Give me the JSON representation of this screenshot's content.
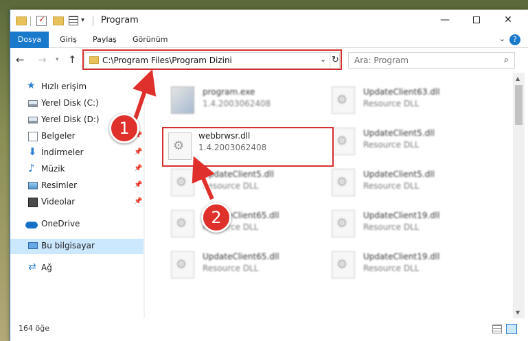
{
  "window": {
    "title": "Program"
  },
  "ribbon": {
    "tabs": [
      "Dosya",
      "Giriş",
      "Paylaş",
      "Görünüm"
    ]
  },
  "address": {
    "path": "C:\\Program Files\\Program Dizini"
  },
  "search": {
    "placeholder": "Ara: Program"
  },
  "sidebar": {
    "items": [
      {
        "label": "Hızlı erişim",
        "icon": "star-icon"
      },
      {
        "label": "Yerel Disk (C:)",
        "icon": "drive-icon"
      },
      {
        "label": "Yerel Disk (D:)",
        "icon": "drive-icon"
      },
      {
        "label": "Belgeler",
        "icon": "document-icon"
      },
      {
        "label": "İndirmeler",
        "icon": "download-icon"
      },
      {
        "label": "Müzik",
        "icon": "music-icon"
      },
      {
        "label": "Resimler",
        "icon": "pictures-icon"
      },
      {
        "label": "Videolar",
        "icon": "video-icon"
      },
      {
        "label": "OneDrive",
        "icon": "cloud-icon"
      },
      {
        "label": "Bu bilgisayar",
        "icon": "computer-icon"
      },
      {
        "label": "Ağ",
        "icon": "network-icon"
      }
    ]
  },
  "files": [
    {
      "name": "program.exe",
      "desc": "1.4.2003062408"
    },
    {
      "name": "UpdateClient63.dll",
      "desc": "Resource DLL"
    },
    {
      "name": "UpdateClient5.dll",
      "desc": "Resource DLL"
    },
    {
      "name": "UpdateClient5.dll",
      "desc": "Resource DLL"
    },
    {
      "name": "UpdateClient5.dll",
      "desc": "Resource DLL"
    },
    {
      "name": "UpdateClient65.dll",
      "desc": "Resource DLL"
    },
    {
      "name": "UpdateClient19.dll",
      "desc": "Resource DLL"
    },
    {
      "name": "UpdateClient65.dll",
      "desc": "Resource DLL"
    },
    {
      "name": "UpdateClient19.dll",
      "desc": "Resource DLL"
    }
  ],
  "highlighted_file": {
    "name": "webbrwsr.dll",
    "desc": "1.4.2003062408"
  },
  "status": {
    "count": "164 öğe"
  },
  "steps": [
    "1",
    "2"
  ],
  "colors": {
    "accent": "#1979ca",
    "highlight": "#d62d2d",
    "step_badge": "#e0302b",
    "selection": "#cce8ff"
  }
}
